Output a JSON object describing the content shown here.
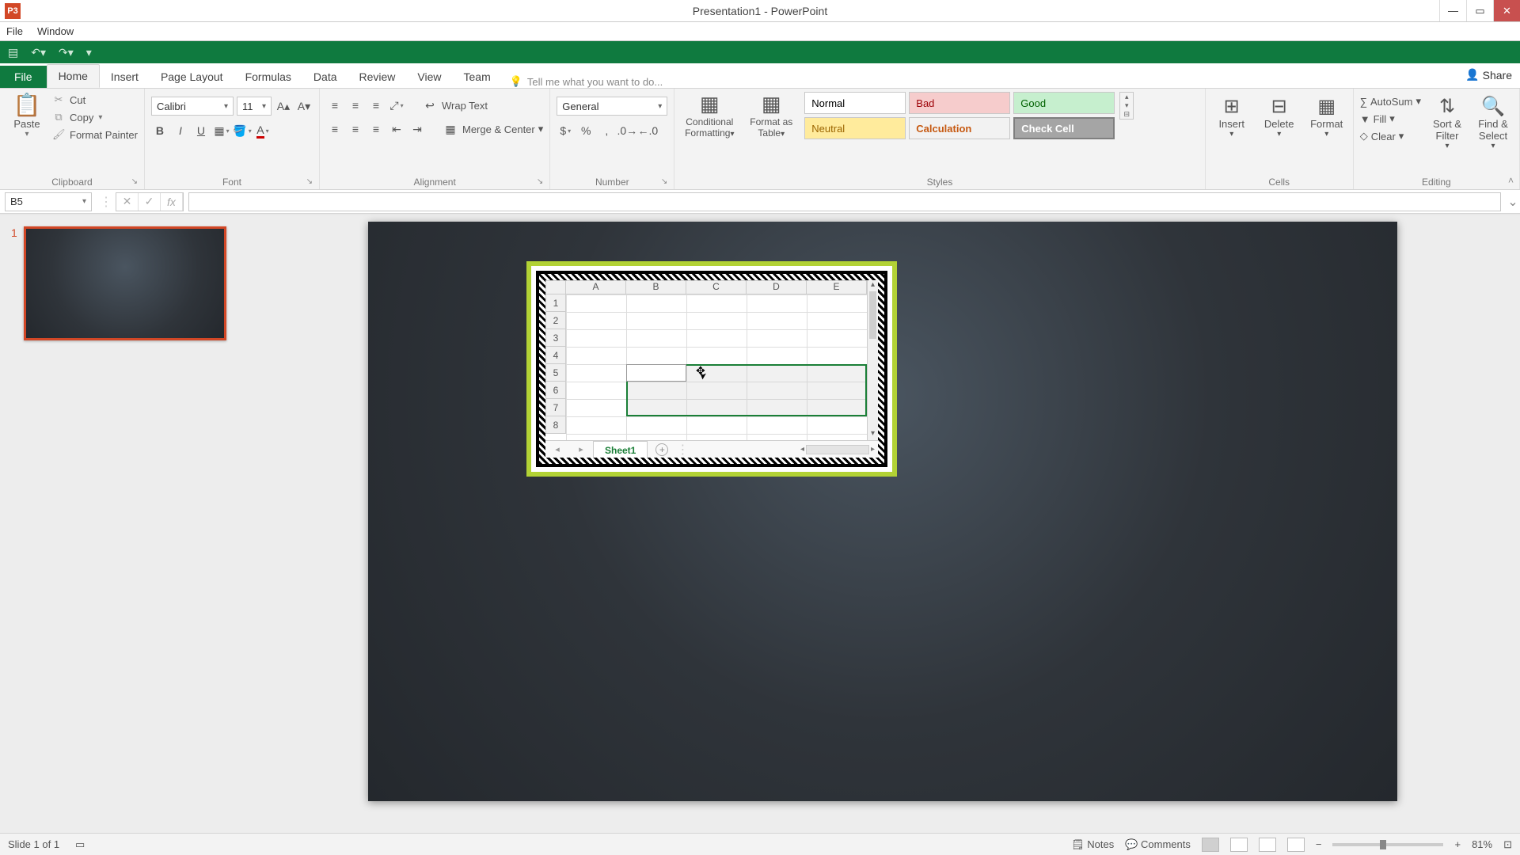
{
  "window": {
    "title": "Presentation1 - PowerPoint",
    "app_icon_label": "P3"
  },
  "menubar": {
    "items": [
      "File",
      "Window"
    ]
  },
  "ribbon_tabs": {
    "file": "File",
    "tabs": [
      "Home",
      "Insert",
      "Page Layout",
      "Formulas",
      "Data",
      "Review",
      "View",
      "Team"
    ],
    "active": "Home",
    "tell_me": "Tell me what you want to do...",
    "share": "Share"
  },
  "ribbon": {
    "clipboard": {
      "paste": "Paste",
      "cut": "Cut",
      "copy": "Copy",
      "format_painter": "Format Painter",
      "label": "Clipboard"
    },
    "font": {
      "name": "Calibri",
      "size": "11",
      "label": "Font"
    },
    "alignment": {
      "wrap": "Wrap Text",
      "merge": "Merge & Center",
      "label": "Alignment"
    },
    "number": {
      "format": "General",
      "label": "Number"
    },
    "styles": {
      "cond": "Conditional Formatting",
      "table": "Format as Table",
      "gallery": {
        "normal": "Normal",
        "bad": "Bad",
        "good": "Good",
        "neutral": "Neutral",
        "calc": "Calculation",
        "check": "Check Cell"
      },
      "label": "Styles"
    },
    "cells": {
      "insert": "Insert",
      "delete": "Delete",
      "format": "Format",
      "label": "Cells"
    },
    "editing": {
      "autosum": "AutoSum",
      "fill": "Fill",
      "clear": "Clear",
      "sort": "Sort & Filter",
      "find": "Find & Select",
      "label": "Editing"
    }
  },
  "formula_bar": {
    "name_box": "B5",
    "formula": ""
  },
  "slide_panel": {
    "slide_number": "1"
  },
  "embedded_sheet": {
    "columns": [
      "A",
      "B",
      "C",
      "D",
      "E"
    ],
    "rows": [
      "1",
      "2",
      "3",
      "4",
      "5",
      "6",
      "7",
      "8"
    ],
    "active_tab": "Sheet1",
    "selection": "B5:E7",
    "active_cell": "B5"
  },
  "statusbar": {
    "slide_info": "Slide 1 of 1",
    "notes": "Notes",
    "comments": "Comments",
    "zoom": "81%"
  }
}
